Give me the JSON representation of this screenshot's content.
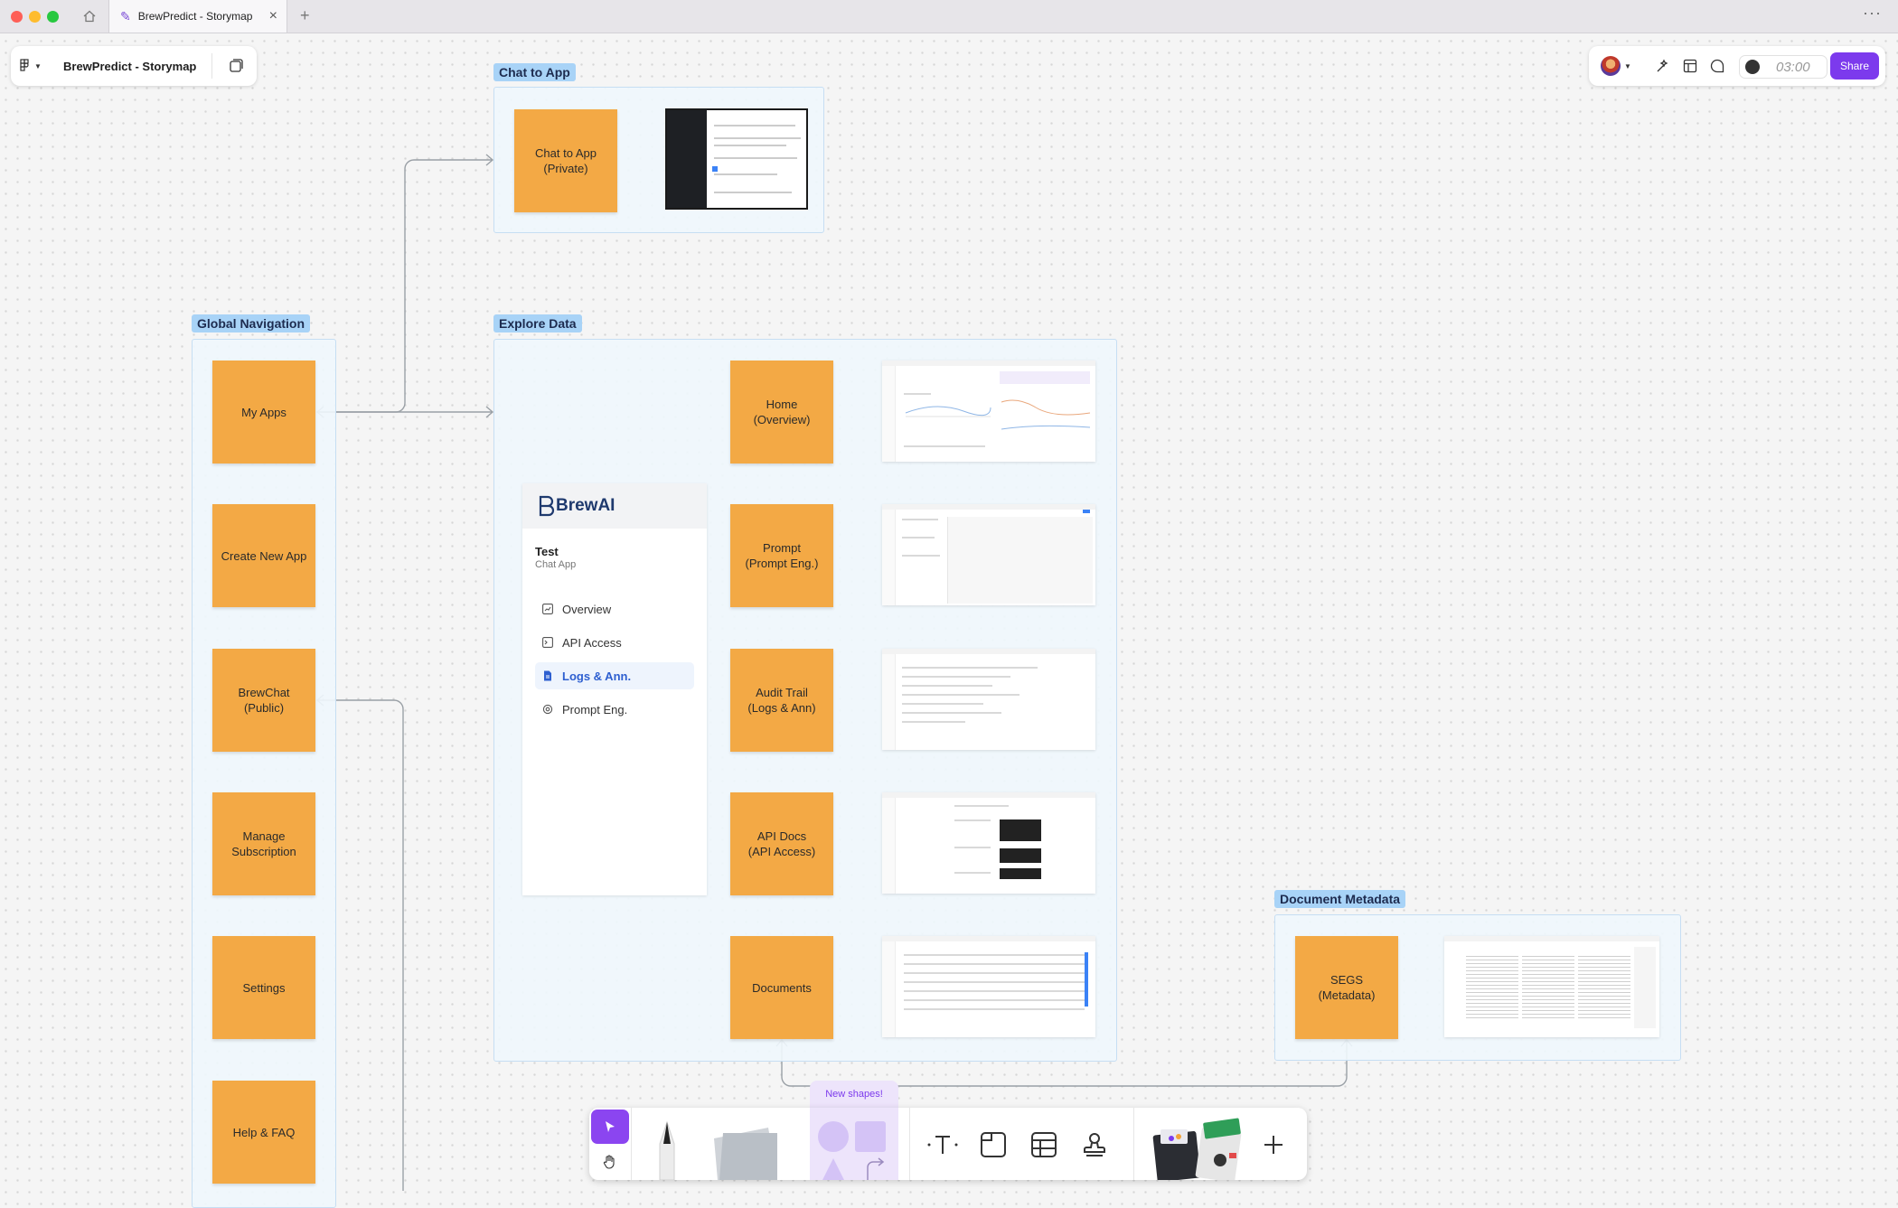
{
  "browser": {
    "tab_title": "BrewPredict - Storymap"
  },
  "file_panel": {
    "file_name": "BrewPredict - Storymap"
  },
  "right_panel": {
    "timer": "03:00",
    "share_label": "Share"
  },
  "sections": {
    "chat_to_app": {
      "label": "Chat to App",
      "stickies": [
        "Chat to App\n(Private)"
      ]
    },
    "global_navigation": {
      "label": "Global Navigation",
      "stickies": [
        "My Apps",
        "Create New App",
        "BrewChat\n(Public)",
        "Manage\nSubscription",
        "Settings",
        "Help & FAQ"
      ]
    },
    "explore_data": {
      "label": "Explore Data",
      "stickies": [
        "Home\n(Overview)",
        "Prompt\n(Prompt Eng.)",
        "Audit Trail\n(Logs & Ann)",
        "API Docs\n(API Access)",
        "Documents"
      ]
    },
    "document_metadata": {
      "label": "Document Metadata",
      "stickies": [
        "SEGS\n(Metadata)"
      ]
    }
  },
  "brewai": {
    "logo": "BrewAI",
    "app_name": "Test",
    "app_type": "Chat App",
    "nav": [
      "Overview",
      "API Access",
      "Logs & Ann.",
      "Prompt Eng."
    ],
    "active_nav": "Logs & Ann."
  },
  "toolbar": {
    "new_shapes_label": "New shapes!"
  },
  "colors": {
    "sticky": "#f3a945",
    "section_label": "#a8d3f7",
    "accent": "#7c3aed"
  }
}
